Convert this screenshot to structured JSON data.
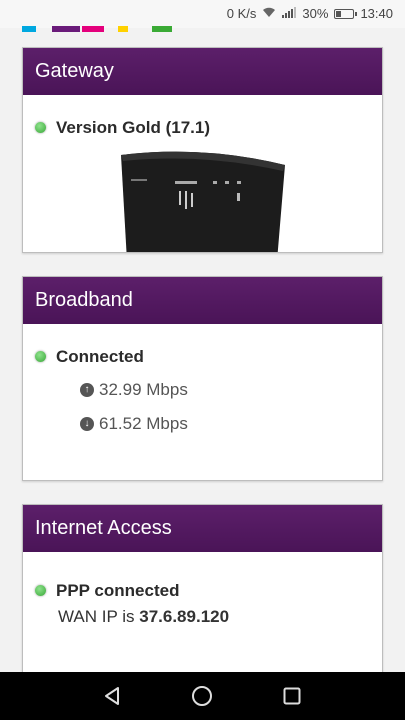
{
  "status_bar": {
    "network_speed": "0 K/s",
    "battery_percent": "30%",
    "time": "13:40",
    "icons": [
      "wifi-icon",
      "signal-icon",
      "battery-icon"
    ]
  },
  "brand_colors": [
    "#00a8e0",
    "#6a1b7a",
    "#e4007c",
    "#ffd100",
    "#3aaa35"
  ],
  "gateway": {
    "title": "Gateway",
    "status_text": "Version Gold (17.1)",
    "status_color": "#3aaa35"
  },
  "broadband": {
    "title": "Broadband",
    "status_text": "Connected",
    "upload": "32.99 Mbps",
    "download": "61.52 Mbps",
    "status_color": "#3aaa35"
  },
  "internet_access": {
    "title": "Internet Access",
    "status_text": "PPP connected",
    "wan_label": "WAN IP is",
    "wan_ip": "37.6.89.120",
    "status_color": "#3aaa35"
  },
  "header_color": "#4f175c",
  "nav": {
    "icons": [
      "back-icon",
      "home-icon",
      "recents-icon"
    ]
  }
}
